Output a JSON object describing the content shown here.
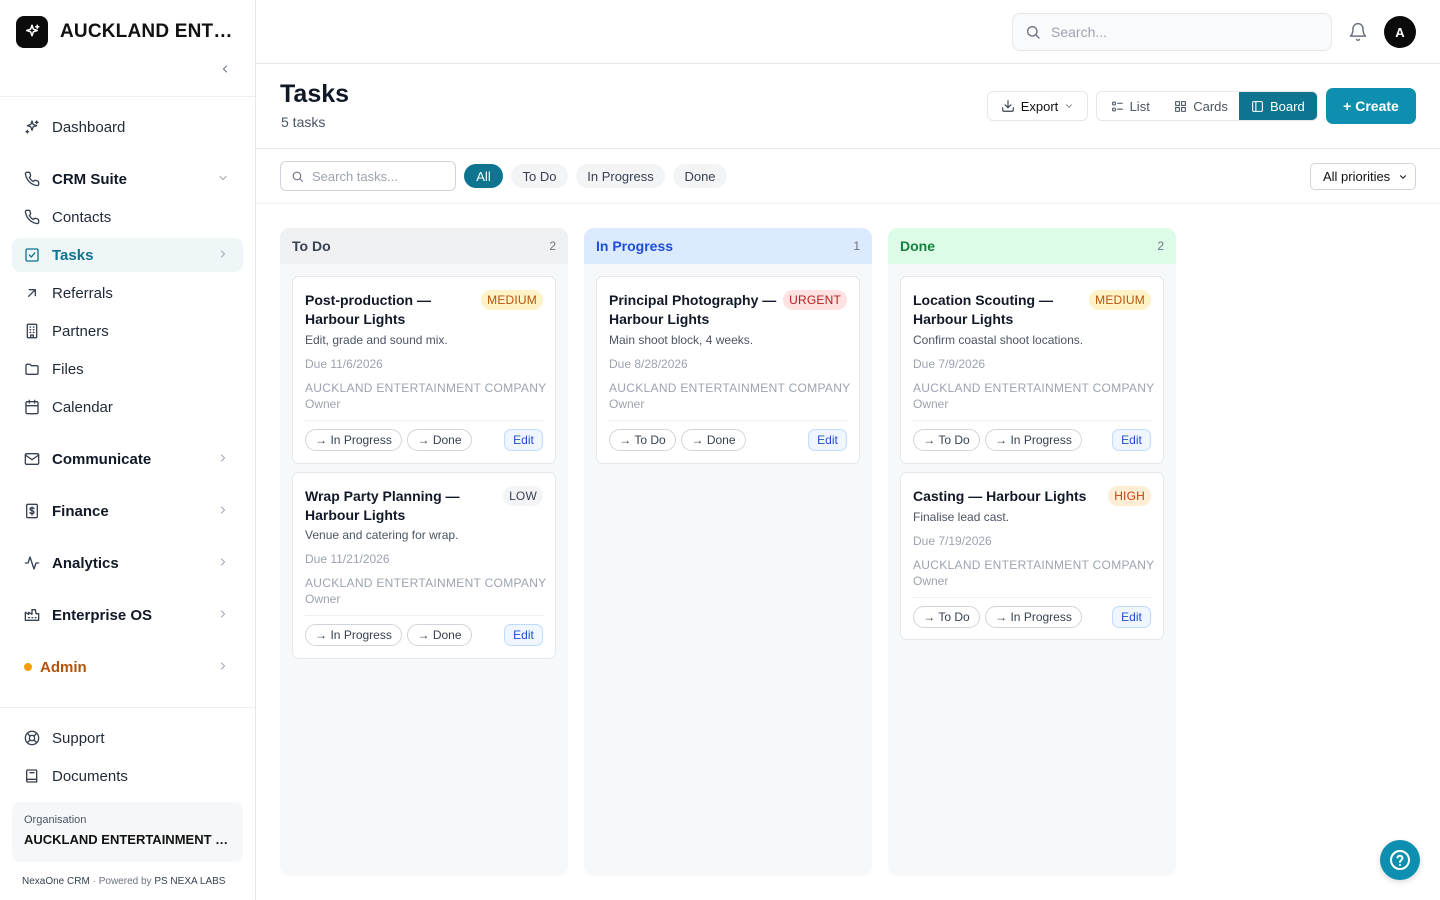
{
  "app": {
    "brand_name": "AUCKLAND ENTERTAINMENT COMPANY",
    "accent_color": "#0e8fb0"
  },
  "sidebar": {
    "items": [
      {
        "label": "Dashboard",
        "icon": "sparkle-icon"
      },
      {
        "label": "CRM Suite",
        "icon": "phone-icon",
        "group": true,
        "expanded": true
      },
      {
        "label": "Contacts",
        "icon": "phone-icon"
      },
      {
        "label": "Tasks",
        "icon": "checkbox-icon",
        "active": true
      },
      {
        "label": "Referrals",
        "icon": "arrow-up-right-icon"
      },
      {
        "label": "Partners",
        "icon": "building-icon"
      },
      {
        "label": "Files",
        "icon": "folder-icon"
      },
      {
        "label": "Calendar",
        "icon": "calendar-icon"
      },
      {
        "label": "Communicate",
        "icon": "mail-icon",
        "group": true
      },
      {
        "label": "Finance",
        "icon": "dollar-icon",
        "group": true
      },
      {
        "label": "Analytics",
        "icon": "activity-icon",
        "group": true
      },
      {
        "label": "Enterprise OS",
        "icon": "factory-icon",
        "group": true
      },
      {
        "label": "Admin",
        "icon": "dot-icon",
        "group": true
      },
      {
        "label": "Support",
        "icon": "lifebuoy-icon"
      },
      {
        "label": "Documents",
        "icon": "book-icon"
      }
    ],
    "org_label": "Organisation",
    "org_name": "AUCKLAND ENTERTAINMENT COMPANY",
    "footer_product": "NexaOne CRM",
    "footer_sep": "·",
    "footer_powered": "Powered by",
    "footer_vendor": "PS NEXA LABS"
  },
  "topbar": {
    "search_placeholder": "Search...",
    "avatar_initial": "A"
  },
  "header": {
    "title": "Tasks",
    "subtitle": "5 tasks",
    "export_label": "Export",
    "views": [
      "List",
      "Cards",
      "Board"
    ],
    "active_view": "Board",
    "create_label": "+ Create"
  },
  "filters": {
    "search_placeholder": "Search tasks...",
    "chips": [
      "All",
      "To Do",
      "In Progress",
      "Done"
    ],
    "active_chip": "All",
    "priority_value": "All priorities"
  },
  "board": {
    "columns": [
      {
        "title": "To Do",
        "count": "2",
        "cards": [
          {
            "title": "Post-production — Harbour Lights",
            "priority": "MEDIUM",
            "desc": "Edit, grade and sound mix.",
            "due": "Due 11/6/2026",
            "company": "AUCKLAND ENTERTAINMENT COMPANY",
            "owner": "Owner",
            "moves": [
              "→ In Progress",
              "→ Done"
            ],
            "edit": "Edit"
          },
          {
            "title": "Wrap Party Planning — Harbour Lights",
            "priority": "LOW",
            "desc": "Venue and catering for wrap.",
            "due": "Due 11/21/2026",
            "company": "AUCKLAND ENTERTAINMENT COMPANY",
            "owner": "Owner",
            "moves": [
              "→ In Progress",
              "→ Done"
            ],
            "edit": "Edit"
          }
        ]
      },
      {
        "title": "In Progress",
        "count": "1",
        "cards": [
          {
            "title": "Principal Photography — Harbour Lights",
            "priority": "URGENT",
            "desc": "Main shoot block, 4 weeks.",
            "due": "Due 8/28/2026",
            "company": "AUCKLAND ENTERTAINMENT COMPANY",
            "owner": "Owner",
            "moves": [
              "→ To Do",
              "→ Done"
            ],
            "edit": "Edit"
          }
        ]
      },
      {
        "title": "Done",
        "count": "2",
        "cards": [
          {
            "title": "Location Scouting — Harbour Lights",
            "priority": "MEDIUM",
            "desc": "Confirm coastal shoot locations.",
            "due": "Due 7/9/2026",
            "company": "AUCKLAND ENTERTAINMENT COMPANY",
            "owner": "Owner",
            "moves": [
              "→ To Do",
              "→ In Progress"
            ],
            "edit": "Edit"
          },
          {
            "title": "Casting — Harbour Lights",
            "priority": "HIGH",
            "desc": "Finalise lead cast.",
            "due": "Due 7/19/2026",
            "company": "AUCKLAND ENTERTAINMENT COMPANY",
            "owner": "Owner",
            "moves": [
              "→ To Do",
              "→ In Progress"
            ],
            "edit": "Edit"
          }
        ]
      }
    ]
  }
}
